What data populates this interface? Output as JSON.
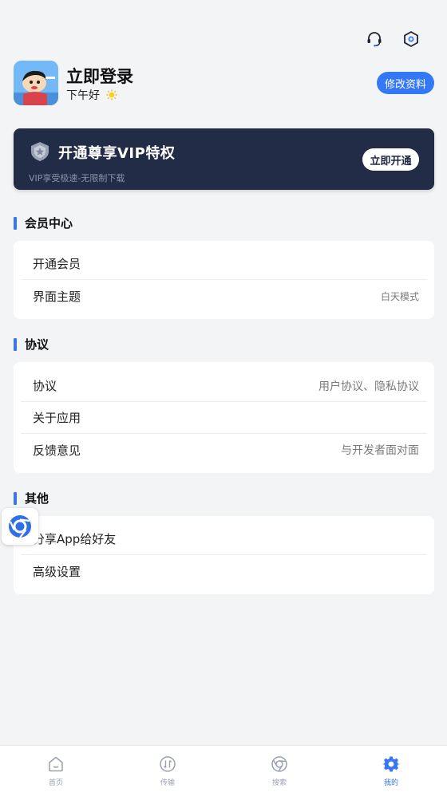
{
  "header": {
    "icons": [
      "headset-icon",
      "settings-hexagon-icon"
    ]
  },
  "profile": {
    "title": "立即登录",
    "greeting": "下午好",
    "greeting_icon": "sun-icon",
    "edit_button": "修改资料"
  },
  "vip": {
    "title": "开通尊享VIP特权",
    "subtitle": "VIP享受极速-无限制下载",
    "button": "立即开通",
    "bg_color": "#232c47"
  },
  "sections": {
    "member": {
      "title": "会员中心",
      "items": [
        {
          "label": "开通会员",
          "value": ""
        },
        {
          "label": "界面主题",
          "value": "白天模式"
        }
      ]
    },
    "agreement": {
      "title": "协议",
      "items": [
        {
          "label": "协议",
          "value": "用户协议、隐私协议"
        },
        {
          "label": "关于应用",
          "value": ""
        },
        {
          "label": "反馈意见",
          "value": "与开发者面对面"
        }
      ]
    },
    "other": {
      "title": "其他",
      "items": [
        {
          "label": "分享App给好友",
          "value": ""
        },
        {
          "label": "高级设置",
          "value": ""
        }
      ]
    }
  },
  "tabbar": {
    "tabs": [
      {
        "label": "首页",
        "icon": "home-icon"
      },
      {
        "label": "传输",
        "icon": "transfer-icon"
      },
      {
        "label": "搜索",
        "icon": "browser-search-icon"
      },
      {
        "label": "我的",
        "icon": "gear-icon"
      }
    ],
    "active": "我的",
    "accent": "#3478f6"
  }
}
